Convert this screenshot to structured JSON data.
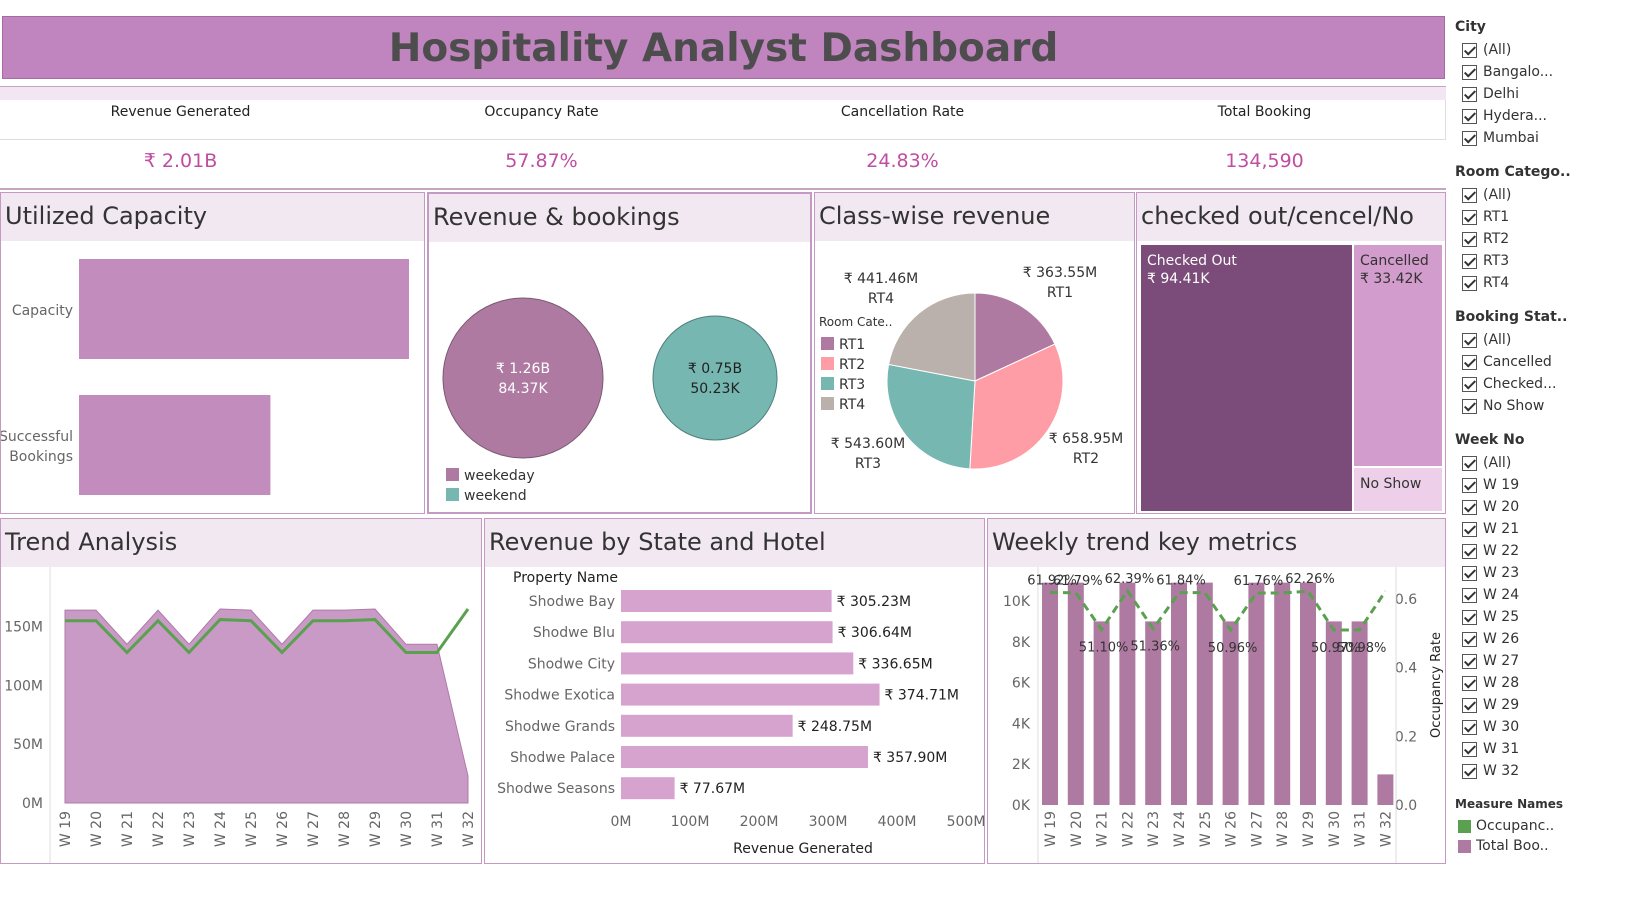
{
  "title": "Hospitality Analyst Dashboard",
  "kpis": [
    {
      "label": "Revenue Generated",
      "value": "₹ 2.01B"
    },
    {
      "label": "Occupancy Rate",
      "value": "57.87%"
    },
    {
      "label": "Cancellation Rate",
      "value": "24.83%"
    },
    {
      "label": "Total Booking",
      "value": "134,590"
    }
  ],
  "panels": {
    "utilized": "Utilized Capacity",
    "revenue_bookings": "Revenue & bookings",
    "class_revenue": "Class-wise revenue",
    "checked": "checked out/cencel/No show",
    "trend": "Trend Analysis",
    "state_hotel": "Revenue by State and Hotel",
    "weekly": "Weekly trend key metrics"
  },
  "filters": {
    "city": {
      "title": "City",
      "items": [
        "(All)",
        "Bangalo...",
        "Delhi",
        "Hydera...",
        "Mumbai"
      ]
    },
    "room": {
      "title": "Room Catego..",
      "items": [
        "(All)",
        "RT1",
        "RT2",
        "RT3",
        "RT4"
      ]
    },
    "booking": {
      "title": "Booking Stat..",
      "items": [
        "(All)",
        "Cancelled",
        "Checked...",
        "No Show"
      ]
    },
    "week": {
      "title": "Week No",
      "items": [
        "(All)",
        "W 19",
        "W 20",
        "W 21",
        "W 22",
        "W 23",
        "W 24",
        "W 25",
        "W 26",
        "W 27",
        "W 28",
        "W 29",
        "W 30",
        "W 31",
        "W 32"
      ]
    },
    "measure": {
      "title": "Measure Names",
      "items": [
        {
          "label": "Occupanc..",
          "color": "#59a14f"
        },
        {
          "label": "Total Boo..",
          "color": "#af7aa1"
        }
      ]
    }
  },
  "colors": {
    "accent": "#c084be",
    "purple": "#af7aa1",
    "teal": "#76b7b2",
    "pink": "#ff9da7",
    "taupe": "#bab0ac",
    "green": "#59a14f",
    "dark_purple": "#7b4b7a"
  },
  "chart_data": [
    {
      "id": "utilized_capacity",
      "type": "bar",
      "title": "Utilized Capacity",
      "categories": [
        "Capacity",
        "Successful Bookings"
      ],
      "values": [
        1.0,
        0.58
      ],
      "value_scale": "relative"
    },
    {
      "id": "revenue_bookings",
      "type": "bubble",
      "title": "Revenue & bookings",
      "series": [
        {
          "name": "weekeday",
          "revenue": 1.26,
          "revenue_label": "₹ 1.26B",
          "bookings_label": "84.37K",
          "color": "#af7aa1"
        },
        {
          "name": "weekend",
          "revenue": 0.75,
          "revenue_label": "₹ 0.75B",
          "bookings_label": "50.23K",
          "color": "#76b7b2"
        }
      ]
    },
    {
      "id": "class_revenue",
      "type": "pie",
      "title": "Class-wise revenue",
      "legend_title": "Room Cate..",
      "slices": [
        {
          "name": "RT1",
          "value": 363.55,
          "label": "₹ 363.55M",
          "color": "#af7aa1"
        },
        {
          "name": "RT2",
          "value": 658.95,
          "label": "₹ 658.95M",
          "color": "#ff9da7"
        },
        {
          "name": "RT3",
          "value": 543.6,
          "label": "₹ 543.60M",
          "color": "#76b7b2"
        },
        {
          "name": "RT4",
          "value": 441.46,
          "label": "₹ 441.46M",
          "color": "#bab0ac"
        }
      ]
    },
    {
      "id": "checked_treemap",
      "type": "treemap",
      "title": "checked out/cencel/No show",
      "items": [
        {
          "name": "Checked Out",
          "label": "₹ 94.41K",
          "color": "#7b4b7a"
        },
        {
          "name": "Cancelled",
          "label": "₹ 33.42K",
          "color": "#d29ccc"
        },
        {
          "name": "No Show",
          "label": "",
          "color": "#edcfea"
        }
      ]
    },
    {
      "id": "trend",
      "type": "area",
      "title": "Trend Analysis",
      "categories": [
        "W 19",
        "W 20",
        "W 21",
        "W 22",
        "W 23",
        "W 24",
        "W 25",
        "W 26",
        "W 27",
        "W 28",
        "W 29",
        "W 30",
        "W 31",
        "W 32"
      ],
      "series": [
        {
          "type": "area",
          "values": [
            164,
            164,
            135,
            164,
            135,
            165,
            164,
            135,
            164,
            164,
            165,
            135,
            135,
            23
          ],
          "color": "#c99ac5"
        },
        {
          "type": "line",
          "values": [
            155,
            155,
            128,
            155,
            128,
            156,
            155,
            128,
            155,
            155,
            156,
            128,
            128,
            165
          ],
          "color": "#59a14f"
        }
      ],
      "yticks": [
        "0M",
        "50M",
        "100M",
        "150M"
      ],
      "ylim": [
        0,
        165
      ]
    },
    {
      "id": "state_hotel",
      "type": "bar",
      "orientation": "horizontal",
      "title": "Revenue by State and Hotel",
      "row_header": "Property Name",
      "categories": [
        "Shodwe Bay",
        "Shodwe Blu",
        "Shodwe City",
        "Shodwe Exotica",
        "Shodwe Grands",
        "Shodwe Palace",
        "Shodwe Seasons"
      ],
      "values": [
        305.23,
        306.64,
        336.65,
        374.71,
        248.75,
        357.9,
        77.67
      ],
      "value_labels": [
        "₹ 305.23M",
        "₹ 306.64M",
        "₹ 336.65M",
        "₹ 374.71M",
        "₹ 248.75M",
        "₹ 357.90M",
        "₹ 77.67M"
      ],
      "xticks": [
        "0M",
        "100M",
        "200M",
        "300M",
        "400M",
        "500M"
      ],
      "xlim": [
        0,
        500
      ],
      "xlabel": "Revenue Generated"
    },
    {
      "id": "weekly",
      "type": "bar",
      "title": "Weekly trend key metrics",
      "categories": [
        "W 19",
        "W 20",
        "W 21",
        "W 22",
        "W 23",
        "W 24",
        "W 25",
        "W 26",
        "W 27",
        "W 28",
        "W 29",
        "W 30",
        "W 31",
        "W 32"
      ],
      "bars": [
        10900,
        10900,
        9000,
        10900,
        9000,
        10900,
        10900,
        9000,
        10900,
        10900,
        10900,
        9000,
        9000,
        1500
      ],
      "line": [
        0.6192,
        0.6179,
        0.511,
        0.6239,
        0.5136,
        0.6184,
        0.6184,
        0.5096,
        0.6176,
        0.6176,
        0.6226,
        0.5097,
        0.5098,
        0.6226
      ],
      "line_labels": [
        "61.92%",
        "61.79%",
        "51.10%",
        "62.39%",
        "51.36%",
        "61.84%",
        "",
        "50.96%",
        "61.76%",
        "",
        "62.26%",
        "50.97%",
        "50.98%",
        ""
      ],
      "yticks_left": [
        "0K",
        "2K",
        "4K",
        "6K",
        "8K",
        "10K"
      ],
      "yticks_right": [
        "0.0",
        "0.2",
        "0.4",
        "0.6"
      ],
      "ylabel_right": "Occupancy Rate",
      "ylim_left": [
        0,
        11000
      ],
      "ylim_right": [
        0,
        0.66
      ]
    }
  ]
}
